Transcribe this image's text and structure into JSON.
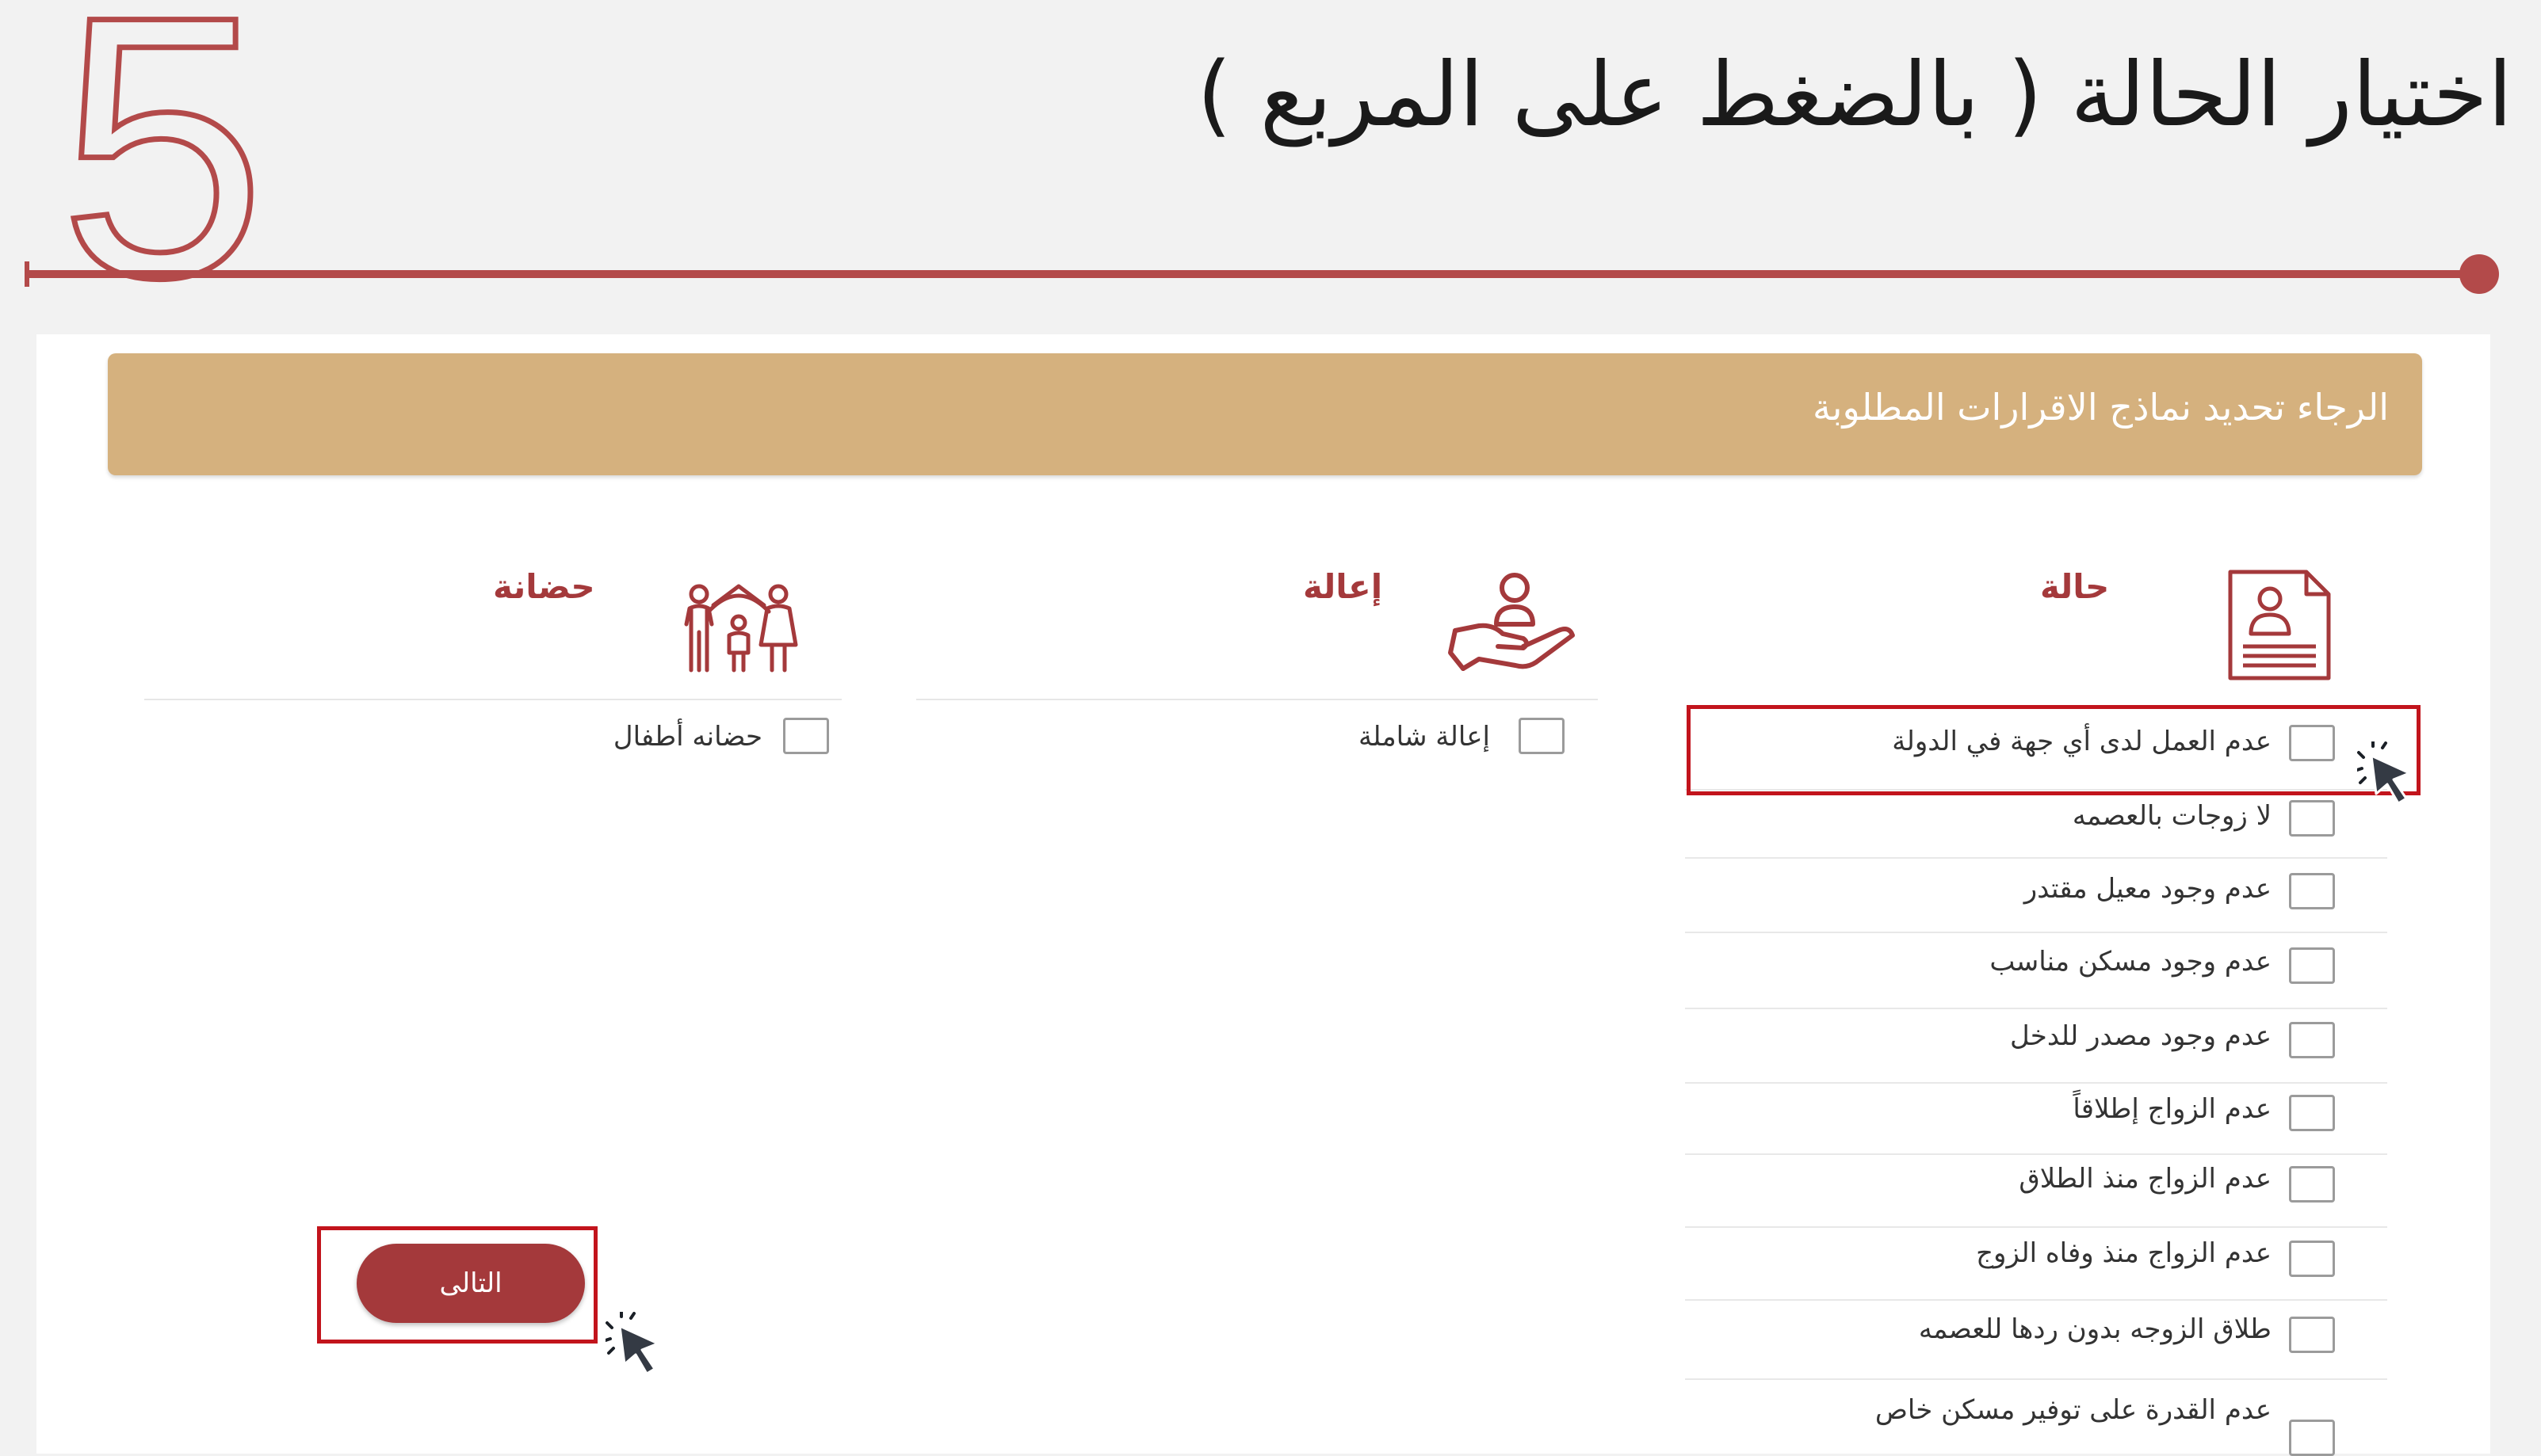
{
  "step": {
    "number": "5",
    "title": "اختيار الحالة ( بالضغط على المربع )",
    "accent_color": "#b34a4a"
  },
  "banner": {
    "text": "الرجاء تحديد نماذج الاقرارات المطلوبة",
    "color": "#d5b17e"
  },
  "columns": {
    "status": {
      "title": "حالة",
      "icon": "document-person-icon",
      "options": [
        {
          "label": "عدم العمل لدى أي جهة في الدولة",
          "checked": false
        },
        {
          "label": "لا زوجات بالعصمه",
          "checked": false
        },
        {
          "label": "عدم وجود معيل مقتدر",
          "checked": false
        },
        {
          "label": "عدم وجود مسكن مناسب",
          "checked": false
        },
        {
          "label": "عدم وجود مصدر للدخل",
          "checked": false
        },
        {
          "label": "عدم الزواج إطلاقاً",
          "checked": false
        },
        {
          "label": "عدم الزواج منذ الطلاق",
          "checked": false
        },
        {
          "label": "عدم الزواج منذ وفاه الزوج",
          "checked": false
        },
        {
          "label": "طلاق الزوجه بدون ردها للعصمه",
          "checked": false
        },
        {
          "label": "عدم القدرة على توفير مسكن خاص",
          "checked": false
        }
      ]
    },
    "support": {
      "title": "إعالة",
      "icon": "hand-person-icon",
      "options": [
        {
          "label": "إعالة شاملة",
          "checked": false
        }
      ]
    },
    "custody": {
      "title": "حضانة",
      "icon": "family-icon",
      "options": [
        {
          "label": "حضانه أطفال",
          "checked": false
        }
      ]
    }
  },
  "next_button": {
    "label": "التالى",
    "color": "#a4393b"
  },
  "highlight_color": "#c2141c",
  "icons": {
    "cursor": "pointer-cursor-icon"
  }
}
